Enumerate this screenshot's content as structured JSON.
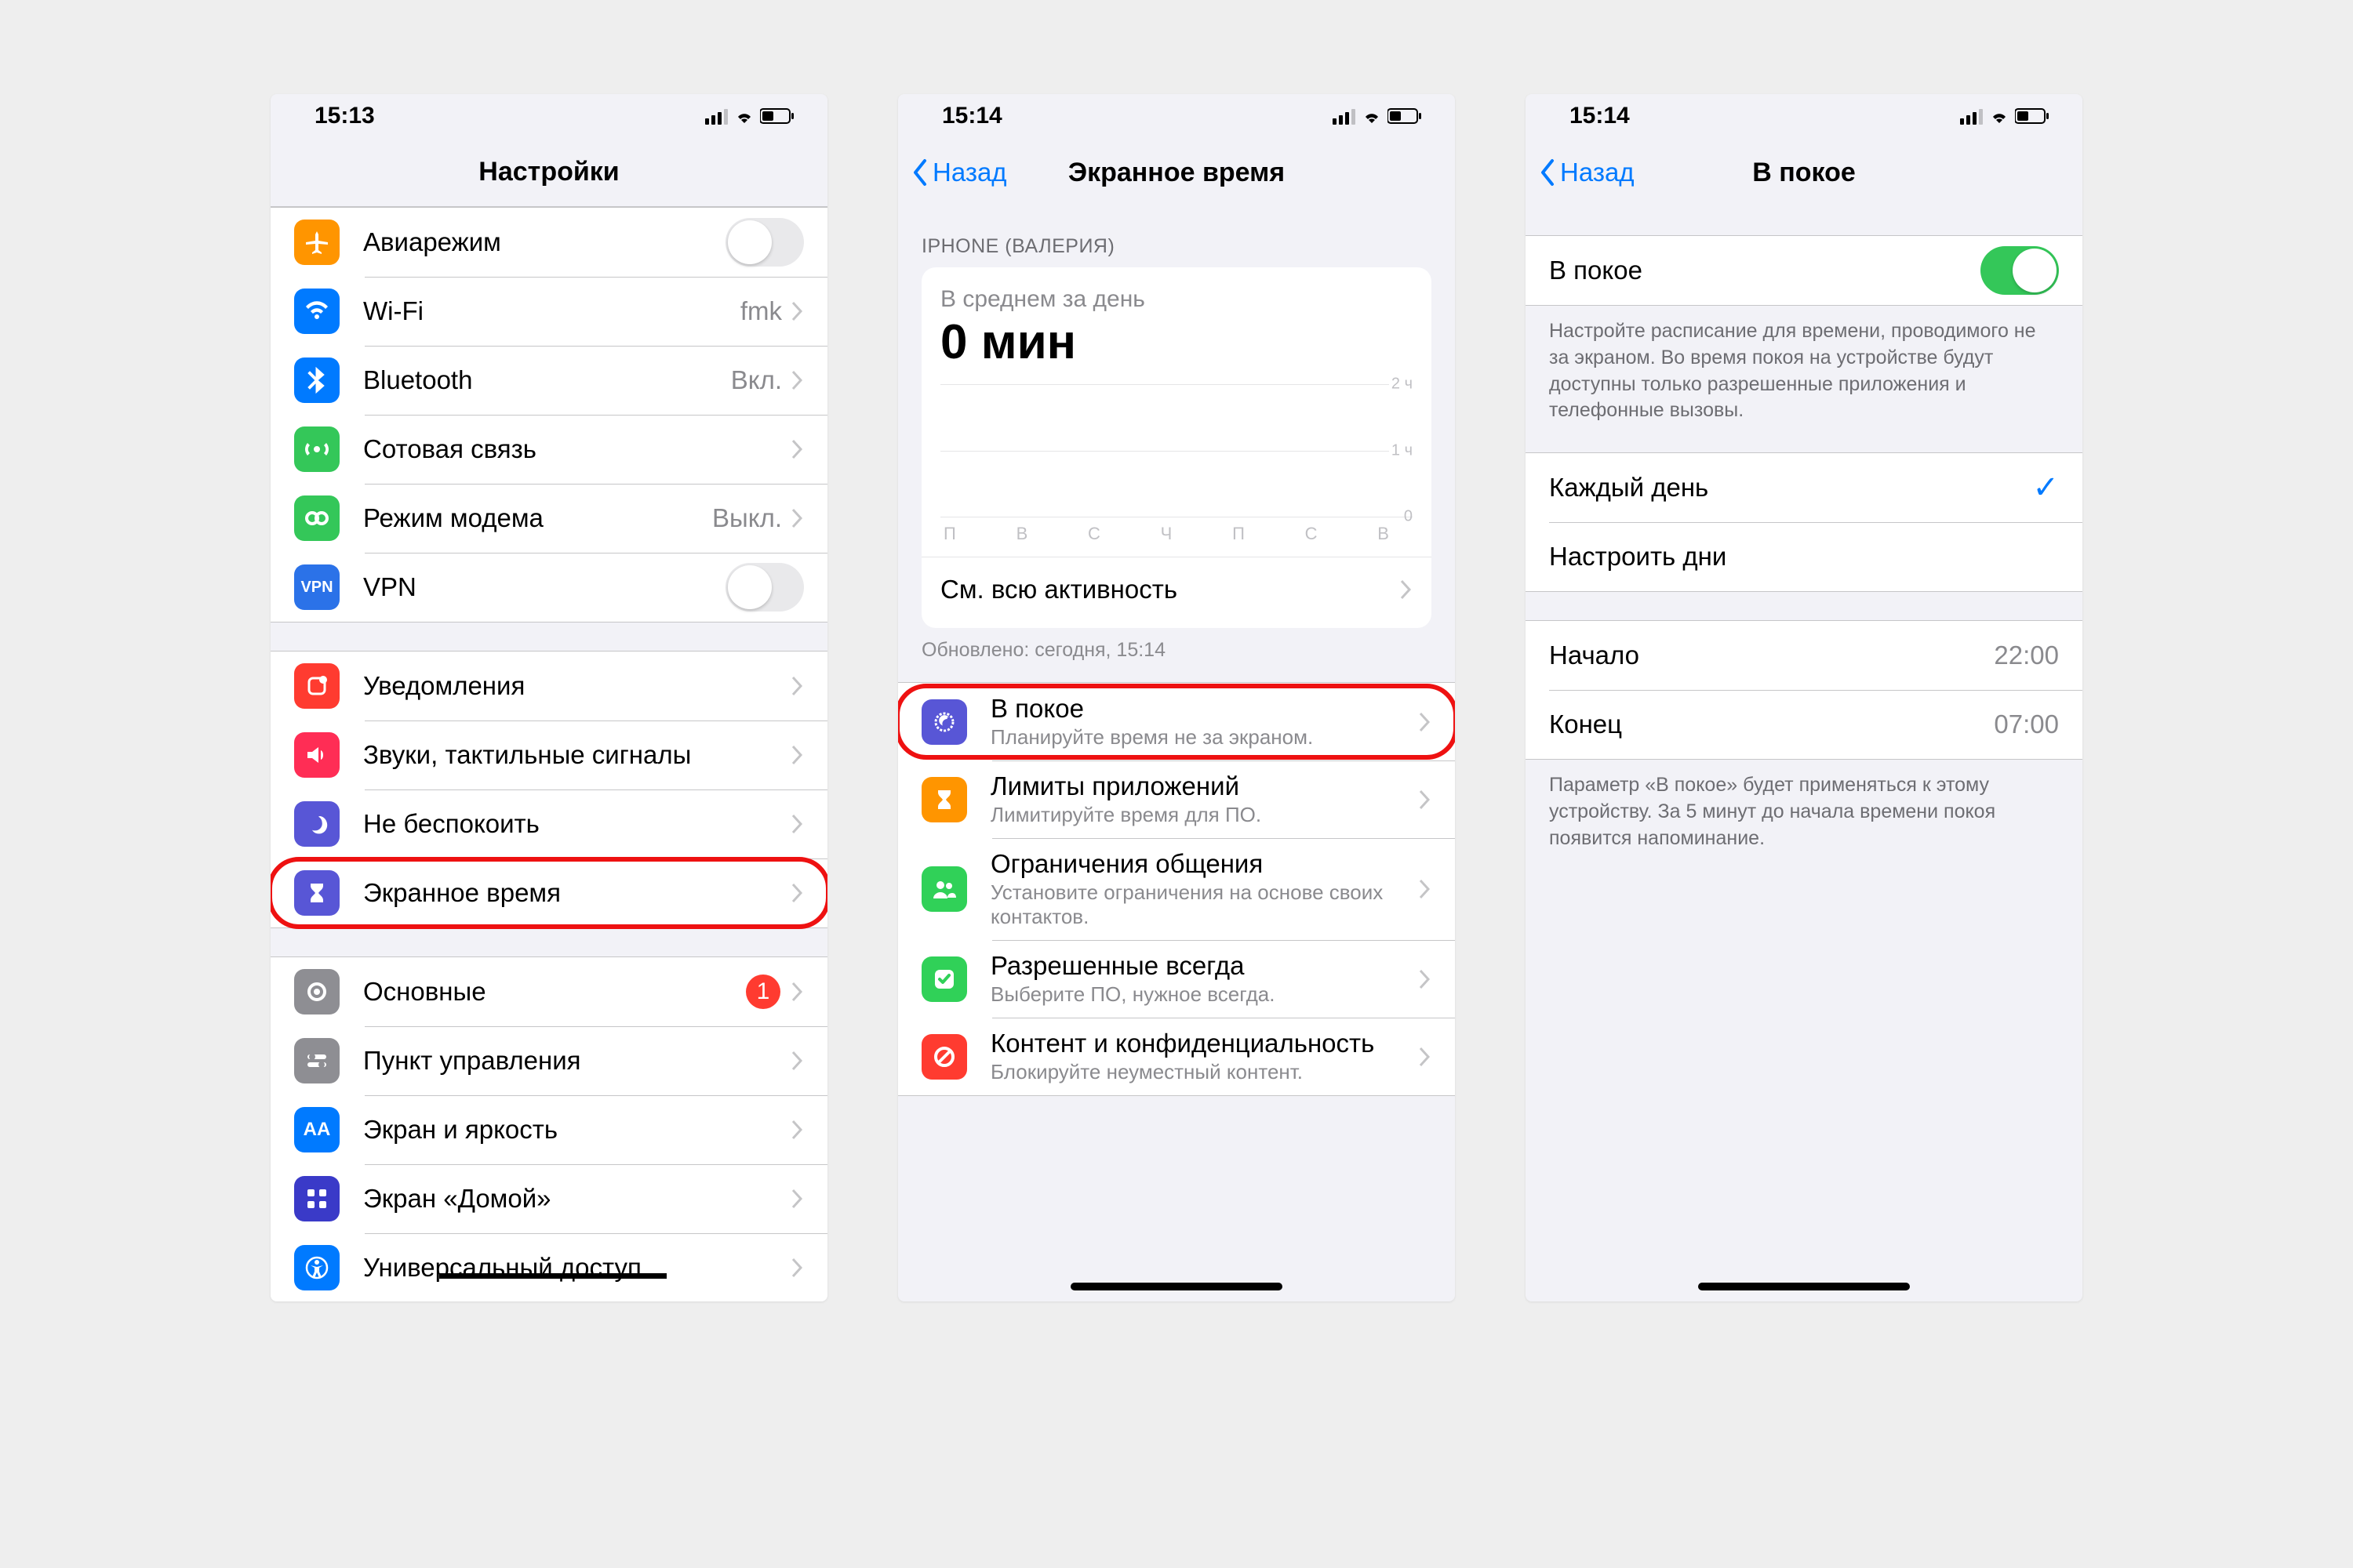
{
  "colors": {
    "orange": "#ff9500",
    "blue": "#007aff",
    "btblue": "#007aff",
    "green": "#34c759",
    "greenicon": "#30d158",
    "red": "#ff3b30",
    "purple": "#5856d6",
    "gray": "#8e8e93",
    "darkgray": "#636366",
    "lightblue": "#32ade6",
    "indigo": "#5856d6",
    "vpnblue": "#2b72e8"
  },
  "screen1": {
    "time": "15:13",
    "title": "Настройки",
    "g1": [
      {
        "icon": "airplane-icon",
        "bg": "#ff9500",
        "label": "Авиарежим",
        "type": "toggle",
        "on": false
      },
      {
        "icon": "wifi-icon",
        "bg": "#007aff",
        "label": "Wi-Fi",
        "value": "fmk",
        "type": "nav"
      },
      {
        "icon": "bluetooth-icon",
        "bg": "#007aff",
        "label": "Bluetooth",
        "value": "Вкл.",
        "type": "nav"
      },
      {
        "icon": "cellular-icon",
        "bg": "#34c759",
        "label": "Сотовая связь",
        "type": "nav"
      },
      {
        "icon": "hotspot-icon",
        "bg": "#34c759",
        "label": "Режим модема",
        "value": "Выкл.",
        "type": "nav"
      },
      {
        "icon": "vpn-icon",
        "bg": "#2b72e8",
        "label": "VPN",
        "type": "toggle",
        "on": false,
        "text": "VPN"
      }
    ],
    "g2": [
      {
        "icon": "bell-icon",
        "bg": "#ff3b30",
        "label": "Уведомления",
        "type": "nav"
      },
      {
        "icon": "sound-icon",
        "bg": "#ff3b56",
        "label": "Звуки, тактильные сигналы",
        "type": "nav"
      },
      {
        "icon": "moon-icon",
        "bg": "#5856d6",
        "label": "Не беспокоить",
        "type": "nav"
      },
      {
        "icon": "hourglass-icon",
        "bg": "#5856d6",
        "label": "Экранное время",
        "type": "nav",
        "highlight": true
      }
    ],
    "g3": [
      {
        "icon": "gear-icon",
        "bg": "#8e8e93",
        "label": "Основные",
        "type": "nav",
        "badge": "1"
      },
      {
        "icon": "control-icon",
        "bg": "#8e8e93",
        "label": "Пункт управления",
        "type": "nav"
      },
      {
        "icon": "brightness-icon",
        "bg": "#007aff",
        "label": "Экран и яркость",
        "type": "nav",
        "text": "AA"
      },
      {
        "icon": "home-icon",
        "bg": "#3355dd",
        "label": "Экран «Домой»",
        "type": "nav"
      },
      {
        "icon": "accessibility-icon",
        "bg": "#007aff",
        "label": "Универсальный доступ",
        "type": "nav",
        "redacted": true
      }
    ]
  },
  "screen2": {
    "time": "15:14",
    "back": "Назад",
    "title": "Экранное время",
    "device": "IPHONE (ВАЛЕРИЯ)",
    "avg_label": "В среднем за день",
    "avg_value": "0 мин",
    "yaxis": [
      "2 ч",
      "1 ч",
      "0"
    ],
    "days": [
      "П",
      "В",
      "С",
      "Ч",
      "П",
      "С",
      "В"
    ],
    "see_all": "См. всю активность",
    "updated": "Обновлено: сегодня, 15:14",
    "items": [
      {
        "icon": "moon2-icon",
        "bg": "#5856d6",
        "label": "В покое",
        "sub": "Планируйте время не за экраном.",
        "highlight": true
      },
      {
        "icon": "hourglass2-icon",
        "bg": "#ff9500",
        "label": "Лимиты приложений",
        "sub": "Лимитируйте время для ПО."
      },
      {
        "icon": "people-icon",
        "bg": "#30d158",
        "label": "Ограничения общения",
        "sub": "Установите ограничения на основе своих контактов."
      },
      {
        "icon": "check-icon",
        "bg": "#30d158",
        "label": "Разрешенные всегда",
        "sub": "Выберите ПО, нужное всегда."
      },
      {
        "icon": "block-icon",
        "bg": "#ff3b30",
        "label": "Контент и конфиденциальность",
        "sub": "Блокируйте неуместный контент."
      }
    ]
  },
  "screen3": {
    "time": "15:14",
    "back": "Назад",
    "title": "В покое",
    "toggle_label": "В покое",
    "toggle_on": true,
    "desc": "Настройте расписание для времени, проводимого не за экраном. Во время покоя на устройстве будут доступны только разрешенные приложения и телефонные вызовы.",
    "daily": "Каждый день",
    "custom": "Настроить дни",
    "start_label": "Начало",
    "start_value": "22:00",
    "end_label": "Конец",
    "end_value": "07:00",
    "footer": "Параметр «В покое» будет применяться к этому устройству. За 5 минут до начала времени покоя появится напоминание."
  },
  "chart_data": {
    "type": "bar",
    "categories": [
      "П",
      "В",
      "С",
      "Ч",
      "П",
      "С",
      "В"
    ],
    "values": [
      0,
      0,
      0,
      0,
      0,
      0,
      0
    ],
    "title": "В среднем за день",
    "ylabel": "часы",
    "ylim": [
      0,
      2
    ],
    "yticks": [
      0,
      1,
      2
    ]
  }
}
